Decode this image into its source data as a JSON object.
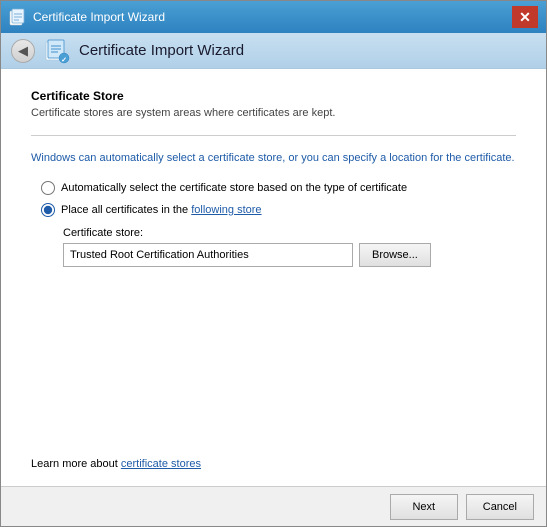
{
  "window": {
    "title": "Certificate Import Wizard",
    "close_label": "✕"
  },
  "nav": {
    "back_label": "◀",
    "title": "Certificate Import Wizard"
  },
  "section": {
    "title": "Certificate Store",
    "description": "Certificate stores are system areas where certificates are kept."
  },
  "info_text": "Windows can automatically select a certificate store, or you can specify a location for the certificate.",
  "radio": {
    "option1_label": "Automatically select the certificate store based on the type of certificate",
    "option2_label": "Place all certificates in the following store"
  },
  "cert_store": {
    "label": "Certificate store:",
    "value": "Trusted Root Certification Authorities",
    "browse_label": "Browse..."
  },
  "footer": {
    "learn_more_prefix": "Learn more about ",
    "learn_more_link": "certificate stores"
  },
  "buttons": {
    "next_label": "Next",
    "cancel_label": "Cancel"
  }
}
